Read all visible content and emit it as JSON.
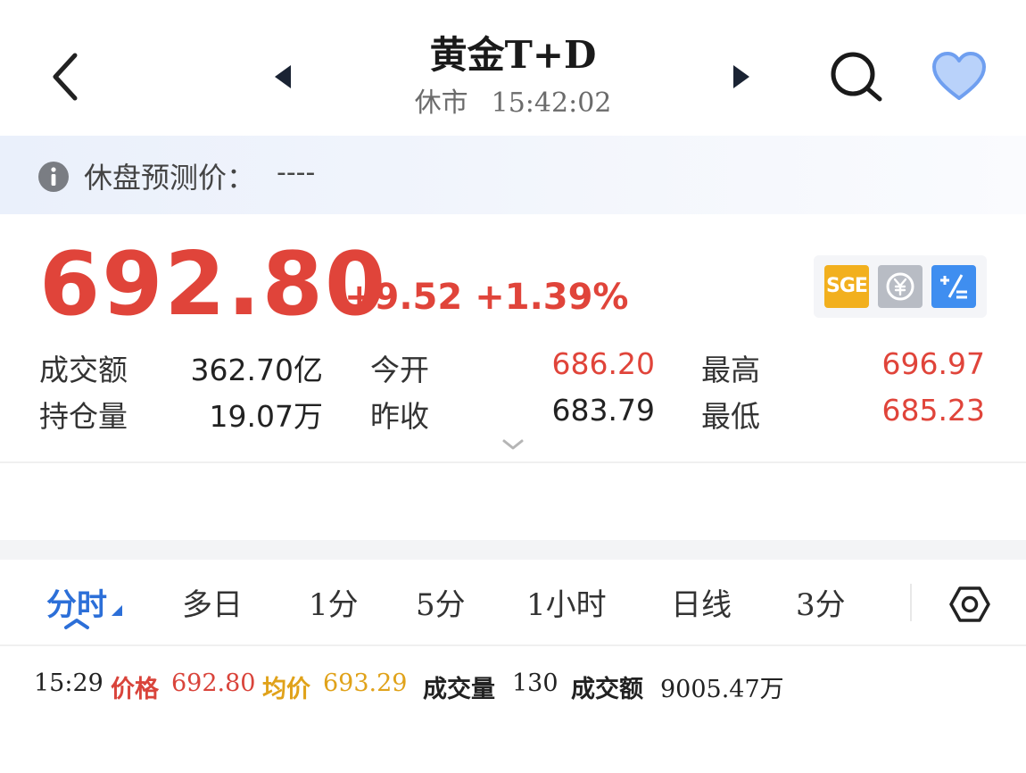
{
  "header": {
    "title": "黄金T+D",
    "status": "休市",
    "time": "15:42:02",
    "icons": [
      "back-icon",
      "prev-arrow-icon",
      "next-arrow-icon",
      "search-icon",
      "heart-icon"
    ]
  },
  "predict": {
    "label": "休盘预测价：",
    "value": "----"
  },
  "quote": {
    "price": "692.80",
    "change": "+9.52",
    "change_pct": "+1.39%",
    "badges": [
      "SGE",
      "cny-icon",
      "calculator-icon"
    ]
  },
  "stats": {
    "turnover_label": "成交额",
    "turnover_value": "362.70亿",
    "open_label": "今开",
    "open_value": "686.20",
    "high_label": "最高",
    "high_value": "696.97",
    "position_label": "持仓量",
    "position_value": "19.07万",
    "prev_close_label": "昨收",
    "prev_close_value": "683.79",
    "low_label": "最低",
    "low_value": "685.23"
  },
  "tabs": {
    "items": [
      "分时",
      "多日",
      "1分",
      "5分",
      "1小时",
      "日线",
      "3分"
    ],
    "active": "分时"
  },
  "info_line": {
    "time": "15:29",
    "price_label": "价格",
    "price_value": "692.80",
    "avg_label": "均价",
    "avg_value": "693.29",
    "volume_label": "成交量",
    "volume_value": "130",
    "amount_label": "成交额",
    "amount_value": "9005.47万"
  },
  "colors": {
    "up_red": "#e0443a",
    "accent_blue": "#2c6fd8",
    "avg_gold": "#e0a21a",
    "sge_badge": "#f2b01e",
    "calc_badge": "#3f8ef0",
    "heart": "#8fb6f5"
  }
}
